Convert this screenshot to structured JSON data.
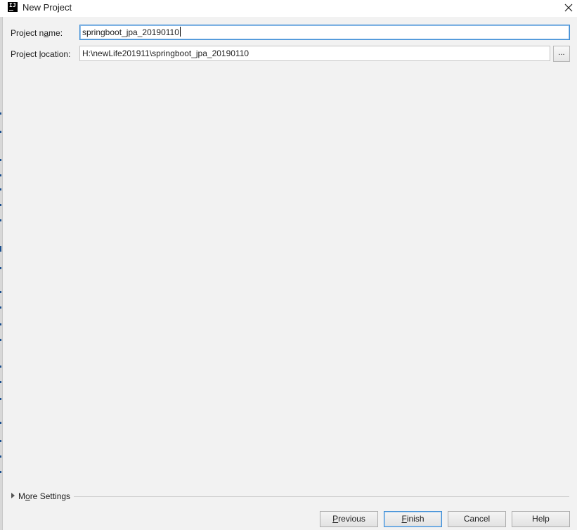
{
  "window": {
    "title": "New Project",
    "app_icon_letters": "IJ",
    "icon": "close-icon"
  },
  "form": {
    "project_name": {
      "label_pre": "Project n",
      "label_mnemonic": "a",
      "label_post": "me:",
      "value": "springboot_jpa_20190110"
    },
    "project_location": {
      "label_pre": "Project ",
      "label_mnemonic": "l",
      "label_post": "ocation:",
      "value": "H:\\newLife201911\\springboot_jpa_20190110",
      "browse_label": "..."
    }
  },
  "more_settings": {
    "label_pre": "M",
    "label_mnemonic": "o",
    "label_post": "re Settings",
    "icon": "expand-triangle-icon"
  },
  "buttons": {
    "previous": {
      "mnemonic": "P",
      "rest": "revious"
    },
    "finish": {
      "mnemonic": "F",
      "rest": "inish"
    },
    "cancel": "Cancel",
    "help": "Help"
  },
  "colors": {
    "background": "#f2f2f2",
    "focus_border": "#3d8dd6",
    "titlebar": "#ffffff"
  }
}
